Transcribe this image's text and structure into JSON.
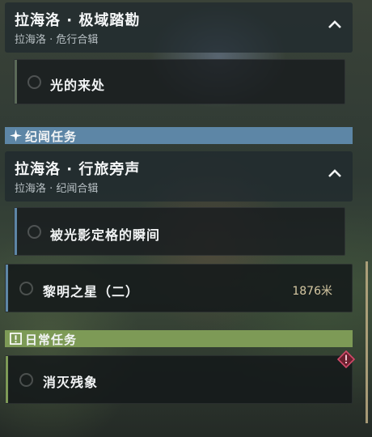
{
  "groups": [
    {
      "title": "拉海洛 · 极域踏勘",
      "subtitle": "拉海洛 · 危行合辑",
      "items": [
        {
          "label": "光的来处"
        }
      ]
    }
  ],
  "section_story": {
    "label": "纪闻任务"
  },
  "group2": {
    "title": "拉海洛 · 行旅旁声",
    "subtitle": "拉海洛 · 纪闻合辑",
    "items": [
      {
        "label": "被光影定格的瞬间"
      },
      {
        "label": "黎明之星（二）",
        "distance": "1876米"
      }
    ]
  },
  "section_daily": {
    "label": "日常任务"
  },
  "daily_items": [
    {
      "label": "消灭残象"
    }
  ],
  "colors": {
    "story_accent": "#5d86a6",
    "daily_accent": "#7d9a56",
    "alert": "#d24a6a"
  },
  "icons": {
    "collapse": "chevron-up-icon",
    "story": "sparkle-icon",
    "daily": "exclamation-box-icon",
    "alert": "diamond-alert-icon"
  }
}
